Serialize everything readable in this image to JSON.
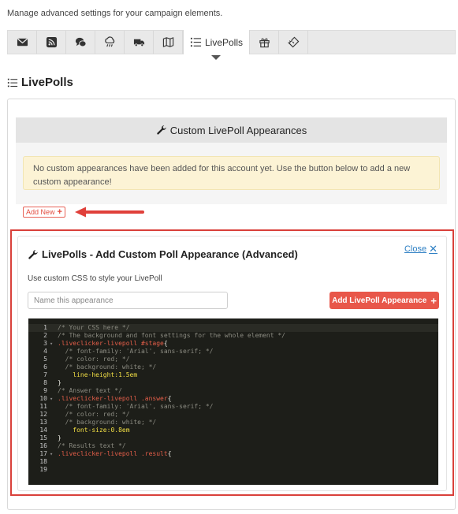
{
  "intro": "Manage advanced settings for your campaign elements.",
  "tabs": [
    {
      "icon": "envelope-icon"
    },
    {
      "icon": "rss-icon"
    },
    {
      "icon": "chat-bubbles-icon"
    },
    {
      "icon": "cloud-rain-icon"
    },
    {
      "icon": "truck-icon"
    },
    {
      "icon": "map-icon"
    },
    {
      "icon": "list-icon",
      "label": "LivePolls",
      "active": true
    },
    {
      "icon": "gift-icon"
    },
    {
      "icon": "ticket-icon"
    }
  ],
  "section_title": "LivePolls",
  "appearances": {
    "header": "Custom LivePoll Appearances",
    "notice": "No custom appearances have been added for this account yet. Use the button below to add a new custom appearance!",
    "add_new_label": "Add New",
    "add_new_plus": "+"
  },
  "advanced": {
    "title": "LivePolls - Add Custom Poll Appearance (Advanced)",
    "close_label": "Close",
    "close_x": "✕",
    "description": "Use custom CSS to style your LivePoll",
    "name_placeholder": "Name this appearance",
    "add_button_label": "Add LivePoll Appearance",
    "add_button_plus": "+"
  },
  "editor": {
    "lines": [
      {
        "n": "1",
        "fold": "",
        "segments": [
          {
            "t": "/* Your CSS here */",
            "c": "c-comment"
          }
        ]
      },
      {
        "n": "2",
        "fold": "",
        "segments": [
          {
            "t": "/* The background and font settings for the whole element */",
            "c": "c-comment"
          }
        ]
      },
      {
        "n": "3",
        "fold": "▾",
        "segments": [
          {
            "t": ".liveclicker-livepoll ",
            "c": "c-sel"
          },
          {
            "t": "#stage",
            "c": "c-sel2"
          },
          {
            "t": "{",
            "c": "c-brace"
          }
        ]
      },
      {
        "n": "4",
        "fold": "",
        "segments": [
          {
            "t": "  /* font-family: 'Arial', sans-serif; */",
            "c": "c-comment"
          }
        ]
      },
      {
        "n": "5",
        "fold": "",
        "segments": [
          {
            "t": "  /* color: red; */",
            "c": "c-comment"
          }
        ]
      },
      {
        "n": "6",
        "fold": "",
        "segments": [
          {
            "t": "  /* background: white; */",
            "c": "c-comment"
          }
        ]
      },
      {
        "n": "7",
        "fold": "",
        "segments": [
          {
            "t": "    line-height:",
            "c": "c-prop"
          },
          {
            "t": "1.5em",
            "c": "c-val"
          }
        ]
      },
      {
        "n": "8",
        "fold": "",
        "segments": [
          {
            "t": "}",
            "c": "c-brace"
          }
        ]
      },
      {
        "n": "9",
        "fold": "",
        "segments": [
          {
            "t": "/* Answer text */",
            "c": "c-comment"
          }
        ]
      },
      {
        "n": "10",
        "fold": "▾",
        "segments": [
          {
            "t": ".liveclicker-livepoll ",
            "c": "c-sel"
          },
          {
            "t": ".answer",
            "c": "c-sel2"
          },
          {
            "t": "{",
            "c": "c-brace"
          }
        ]
      },
      {
        "n": "11",
        "fold": "",
        "segments": [
          {
            "t": "  /* font-family: 'Arial', sans-serif; */",
            "c": "c-comment"
          }
        ]
      },
      {
        "n": "12",
        "fold": "",
        "segments": [
          {
            "t": "  /* color: red; */",
            "c": "c-comment"
          }
        ]
      },
      {
        "n": "13",
        "fold": "",
        "segments": [
          {
            "t": "  /* background: white; */",
            "c": "c-comment"
          }
        ]
      },
      {
        "n": "14",
        "fold": "",
        "segments": [
          {
            "t": "    font-size:",
            "c": "c-prop"
          },
          {
            "t": "0.8em",
            "c": "c-val"
          }
        ]
      },
      {
        "n": "15",
        "fold": "",
        "segments": [
          {
            "t": "}",
            "c": "c-brace"
          }
        ]
      },
      {
        "n": "16",
        "fold": "",
        "segments": [
          {
            "t": "/* Results text */",
            "c": "c-comment"
          }
        ]
      },
      {
        "n": "17",
        "fold": "▾",
        "segments": [
          {
            "t": ".liveclicker-livepoll ",
            "c": "c-sel"
          },
          {
            "t": ".result",
            "c": "c-sel2"
          },
          {
            "t": "{",
            "c": "c-brace"
          }
        ]
      },
      {
        "n": "18",
        "fold": "",
        "segments": []
      },
      {
        "n": "19",
        "fold": "",
        "segments": []
      }
    ]
  },
  "colors": {
    "accent_red": "#e8574a",
    "highlight_border": "#d9403a",
    "link_blue": "#2f80c4",
    "notice_bg": "#fcf3d5",
    "editor_bg": "#1d1e19"
  }
}
